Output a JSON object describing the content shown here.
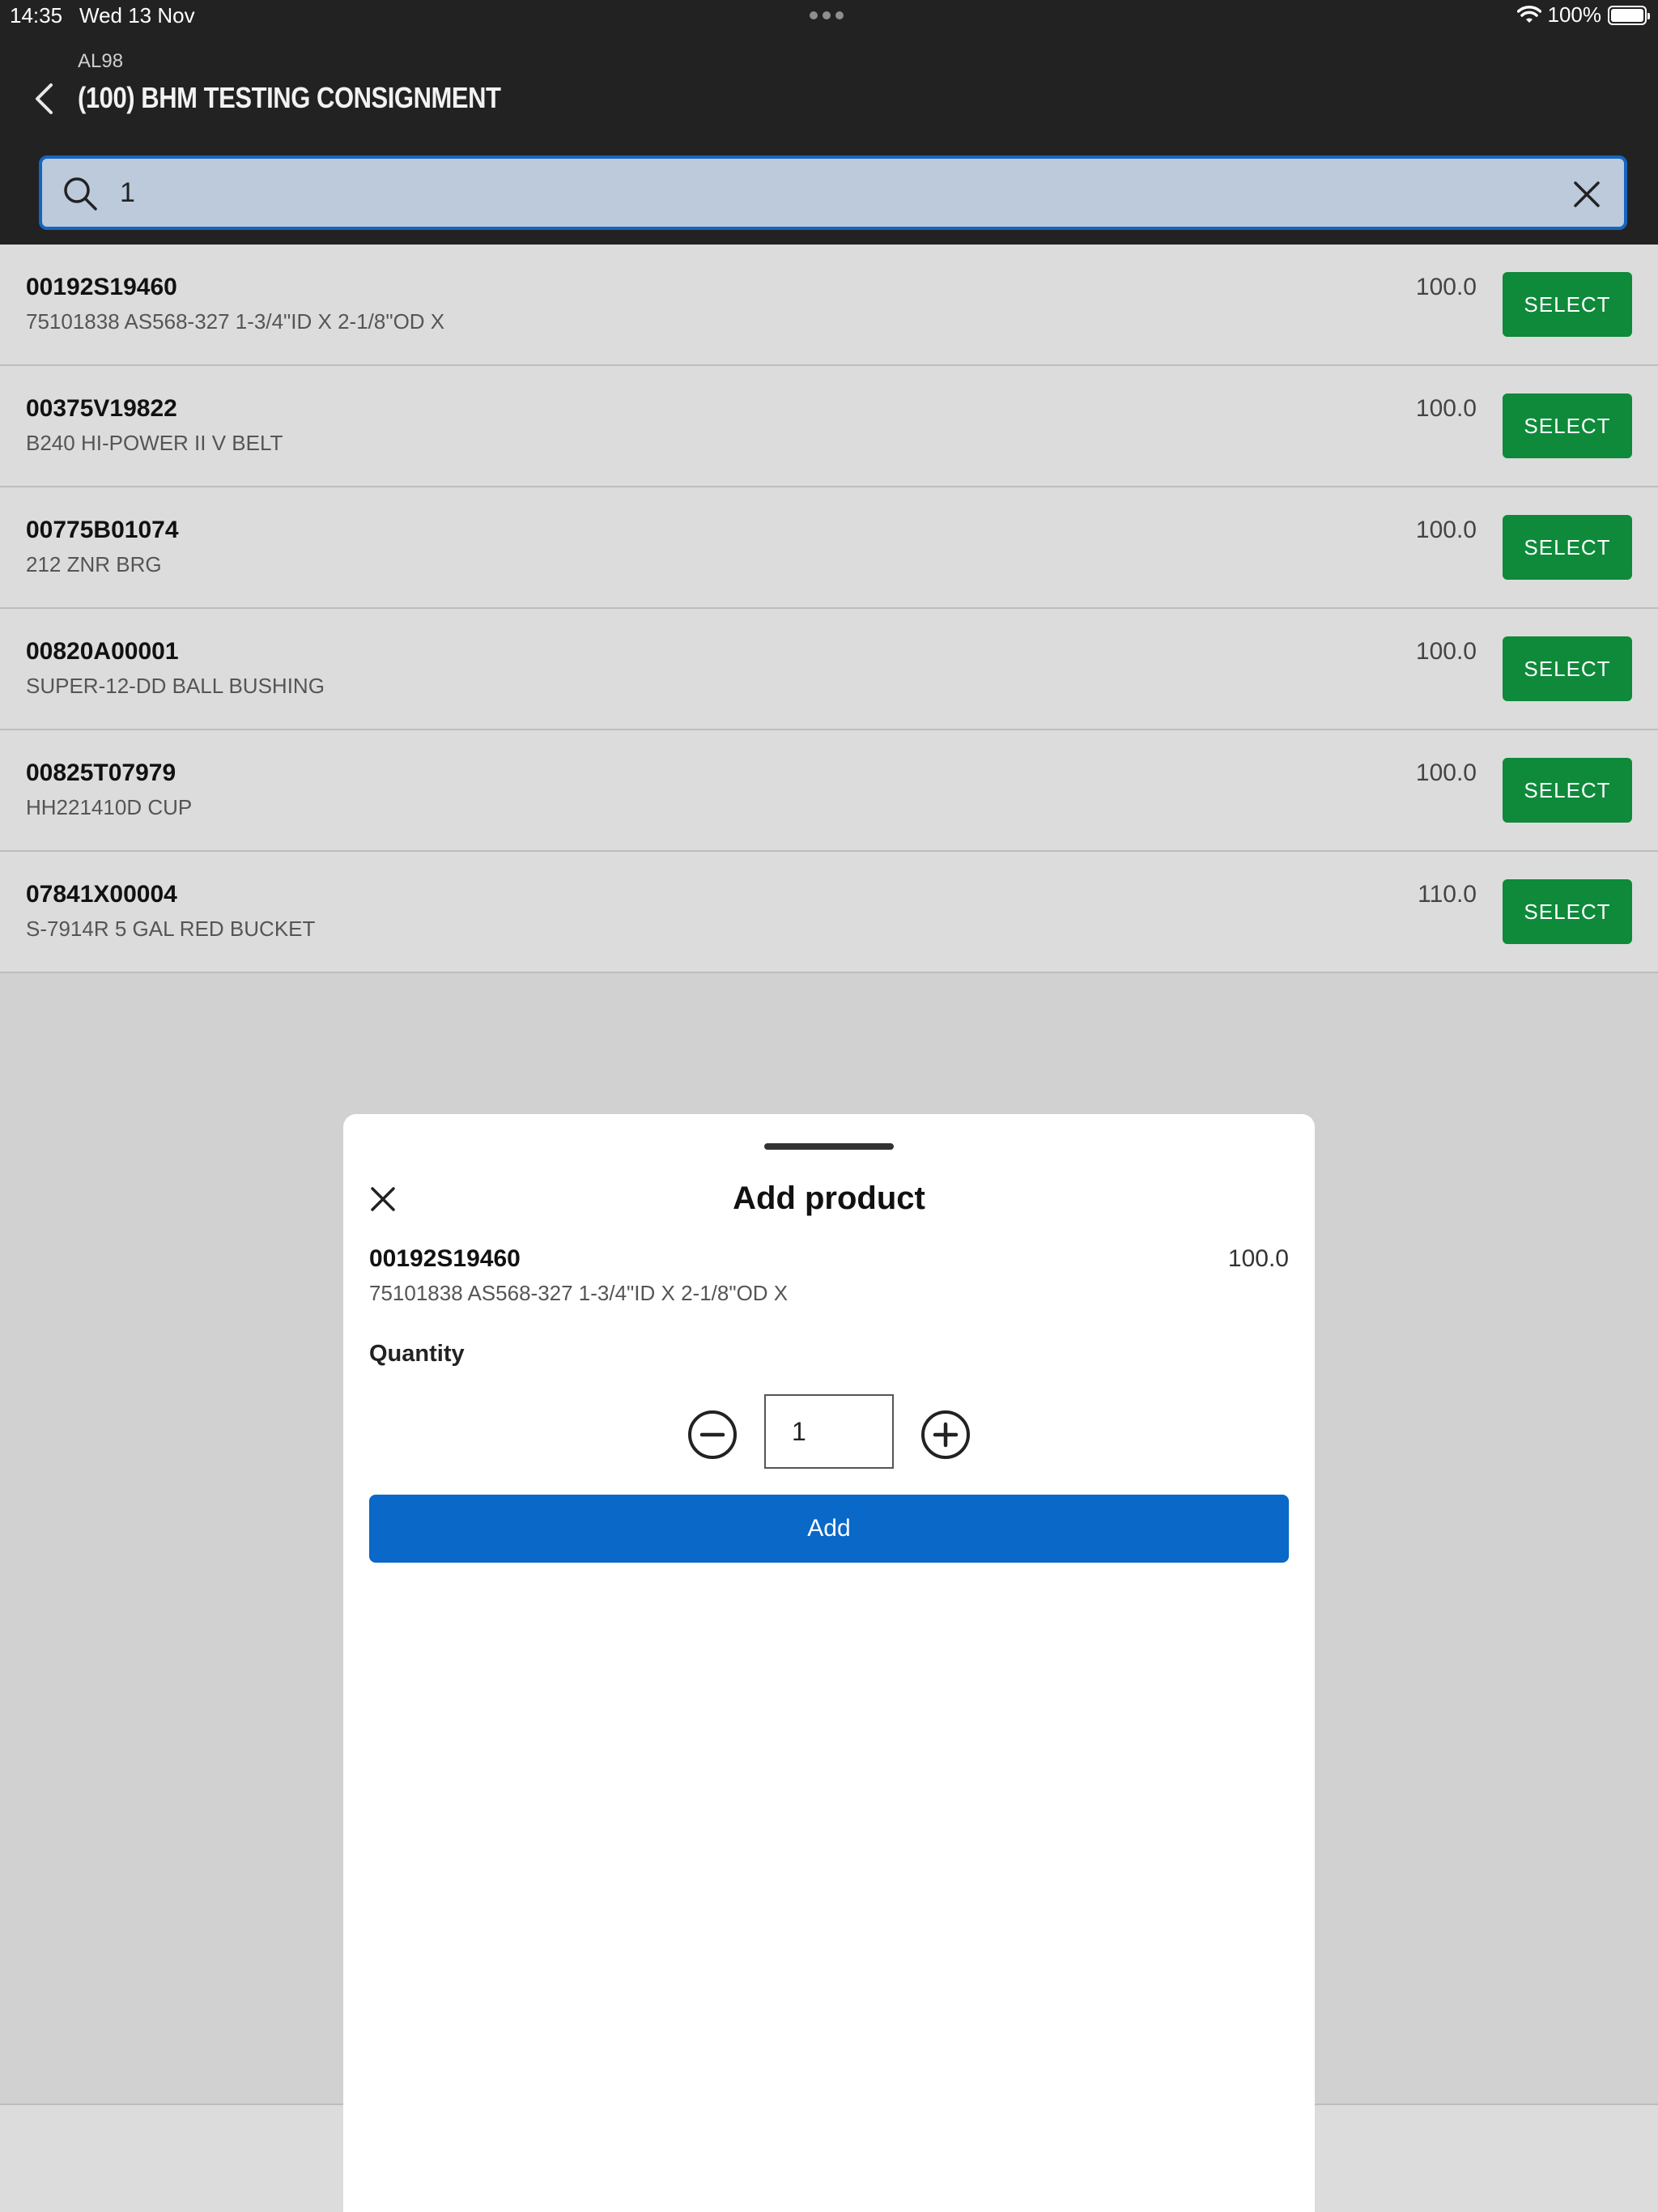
{
  "status_bar": {
    "time": "14:35",
    "date": "Wed 13 Nov",
    "battery": "100%"
  },
  "header": {
    "subtitle": "AL98",
    "title": "(100) BHM TESTING CONSIGNMENT"
  },
  "search": {
    "value": "1"
  },
  "list": [
    {
      "code": "00192S19460",
      "desc": "75101838 AS568-327 1-3/4\"ID X 2-1/8\"OD X",
      "qty": "100.0",
      "action": "SELECT"
    },
    {
      "code": "00375V19822",
      "desc": "B240 HI-POWER II V BELT",
      "qty": "100.0",
      "action": "SELECT"
    },
    {
      "code": "00775B01074",
      "desc": "212 ZNR BRG",
      "qty": "100.0",
      "action": "SELECT"
    },
    {
      "code": "00820A00001",
      "desc": "SUPER-12-DD BALL BUSHING",
      "qty": "100.0",
      "action": "SELECT"
    },
    {
      "code": "00825T07979",
      "desc": "HH221410D CUP",
      "qty": "100.0",
      "action": "SELECT"
    },
    {
      "code": "07841X00004",
      "desc": "S-7914R 5 GAL RED BUCKET",
      "qty": "110.0",
      "action": "SELECT"
    }
  ],
  "modal": {
    "title": "Add product",
    "code": "00192S19460",
    "qty": "100.0",
    "desc": "75101838 AS568-327 1-3/4\"ID X 2-1/8\"OD X",
    "quantity_label": "Quantity",
    "quantity_value": "1",
    "add_label": "Add"
  },
  "colors": {
    "header_bg": "#222222",
    "search_bg": "#bccadc",
    "search_border": "#1565c0",
    "select_green": "#0e8a3a",
    "add_blue": "#0a68c8",
    "list_bg": "#dcdcdc",
    "backdrop": "#d1d1d1"
  },
  "icons": [
    "back-chevron-icon",
    "search-icon",
    "clear-icon",
    "close-icon",
    "minus-circle-icon",
    "plus-circle-icon",
    "wifi-icon",
    "battery-icon"
  ]
}
